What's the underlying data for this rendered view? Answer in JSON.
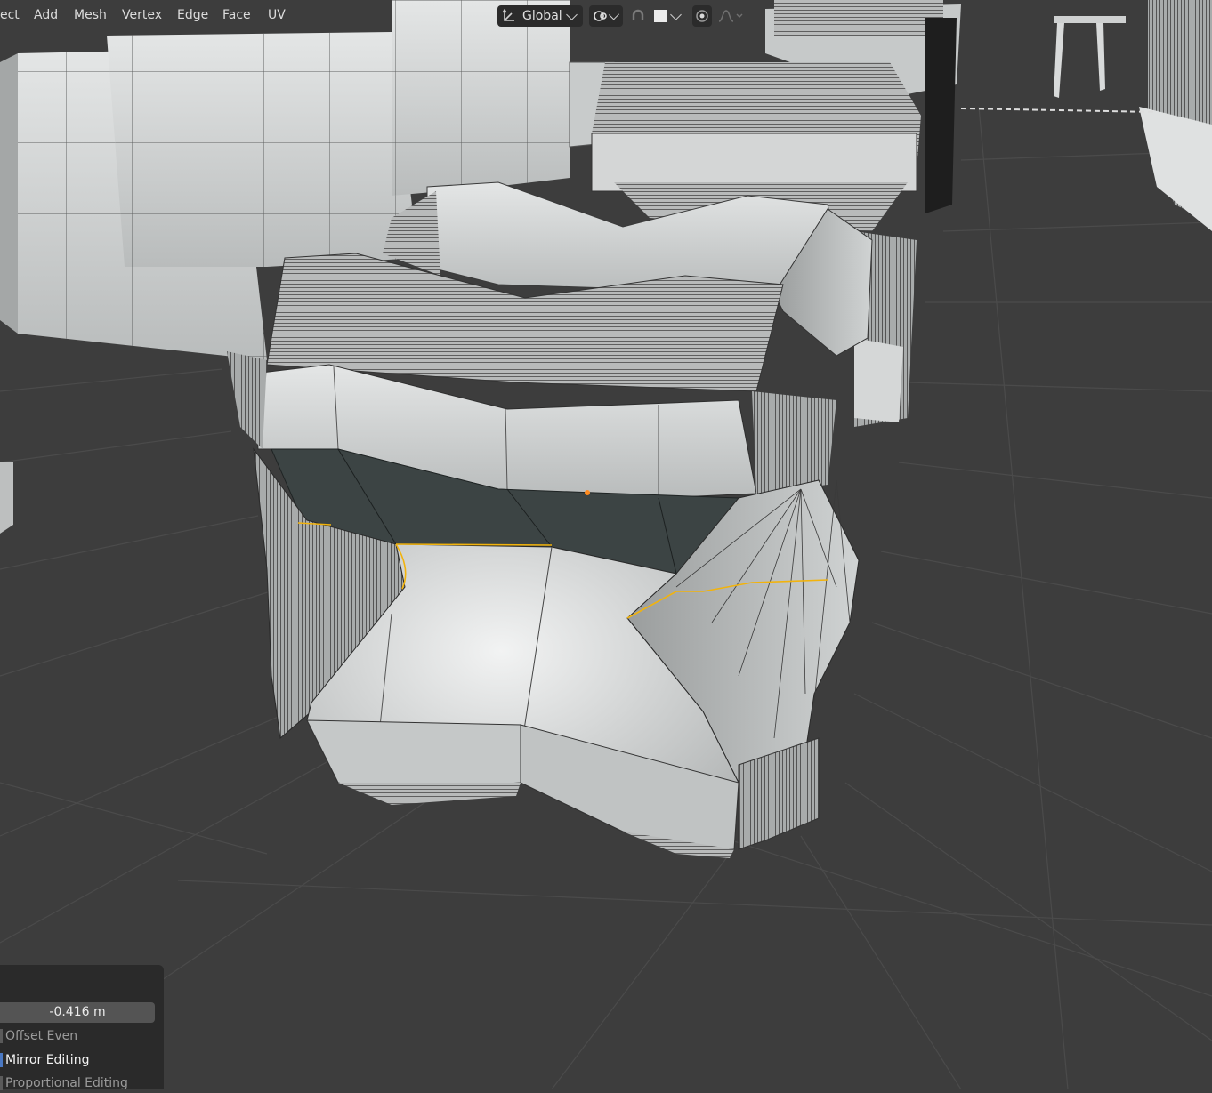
{
  "menu": {
    "select": "ect",
    "add": "Add",
    "mesh": "Mesh",
    "vertex": "Vertex",
    "edge": "Edge",
    "face": "Face",
    "uv": "UV"
  },
  "toolbar": {
    "transform_orientation": "Global",
    "icons": [
      "orientation-icon",
      "snap-icon",
      "magnet-icon",
      "color-swatch-icon",
      "proportional-editing-icon",
      "falloff-curve-icon"
    ]
  },
  "operator_panel": {
    "offset_value": "-0.416 m",
    "offset_even_label": "Offset Even",
    "mirror_editing_label": "Mirror Editing",
    "proportional_editing_label": "Proportional Editing"
  },
  "colors": {
    "viewport_bg": "#3d3d3d",
    "grid": "#4a4a4a",
    "mesh_face": "#c9cccc",
    "selection_edge": "#f2b30c",
    "header_widget": "#2b2b2b",
    "panel_bg": "#2a2a2a"
  }
}
